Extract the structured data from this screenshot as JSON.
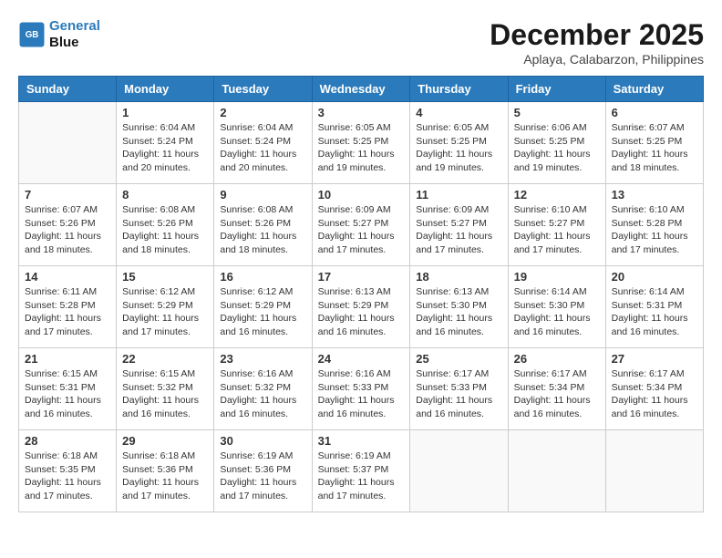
{
  "header": {
    "logo_line1": "General",
    "logo_line2": "Blue",
    "month": "December 2025",
    "location": "Aplaya, Calabarzon, Philippines"
  },
  "weekdays": [
    "Sunday",
    "Monday",
    "Tuesday",
    "Wednesday",
    "Thursday",
    "Friday",
    "Saturday"
  ],
  "weeks": [
    [
      {
        "day": "",
        "info": ""
      },
      {
        "day": "1",
        "info": "Sunrise: 6:04 AM\nSunset: 5:24 PM\nDaylight: 11 hours\nand 20 minutes."
      },
      {
        "day": "2",
        "info": "Sunrise: 6:04 AM\nSunset: 5:24 PM\nDaylight: 11 hours\nand 20 minutes."
      },
      {
        "day": "3",
        "info": "Sunrise: 6:05 AM\nSunset: 5:25 PM\nDaylight: 11 hours\nand 19 minutes."
      },
      {
        "day": "4",
        "info": "Sunrise: 6:05 AM\nSunset: 5:25 PM\nDaylight: 11 hours\nand 19 minutes."
      },
      {
        "day": "5",
        "info": "Sunrise: 6:06 AM\nSunset: 5:25 PM\nDaylight: 11 hours\nand 19 minutes."
      },
      {
        "day": "6",
        "info": "Sunrise: 6:07 AM\nSunset: 5:25 PM\nDaylight: 11 hours\nand 18 minutes."
      }
    ],
    [
      {
        "day": "7",
        "info": "Sunrise: 6:07 AM\nSunset: 5:26 PM\nDaylight: 11 hours\nand 18 minutes."
      },
      {
        "day": "8",
        "info": "Sunrise: 6:08 AM\nSunset: 5:26 PM\nDaylight: 11 hours\nand 18 minutes."
      },
      {
        "day": "9",
        "info": "Sunrise: 6:08 AM\nSunset: 5:26 PM\nDaylight: 11 hours\nand 18 minutes."
      },
      {
        "day": "10",
        "info": "Sunrise: 6:09 AM\nSunset: 5:27 PM\nDaylight: 11 hours\nand 17 minutes."
      },
      {
        "day": "11",
        "info": "Sunrise: 6:09 AM\nSunset: 5:27 PM\nDaylight: 11 hours\nand 17 minutes."
      },
      {
        "day": "12",
        "info": "Sunrise: 6:10 AM\nSunset: 5:27 PM\nDaylight: 11 hours\nand 17 minutes."
      },
      {
        "day": "13",
        "info": "Sunrise: 6:10 AM\nSunset: 5:28 PM\nDaylight: 11 hours\nand 17 minutes."
      }
    ],
    [
      {
        "day": "14",
        "info": "Sunrise: 6:11 AM\nSunset: 5:28 PM\nDaylight: 11 hours\nand 17 minutes."
      },
      {
        "day": "15",
        "info": "Sunrise: 6:12 AM\nSunset: 5:29 PM\nDaylight: 11 hours\nand 17 minutes."
      },
      {
        "day": "16",
        "info": "Sunrise: 6:12 AM\nSunset: 5:29 PM\nDaylight: 11 hours\nand 16 minutes."
      },
      {
        "day": "17",
        "info": "Sunrise: 6:13 AM\nSunset: 5:29 PM\nDaylight: 11 hours\nand 16 minutes."
      },
      {
        "day": "18",
        "info": "Sunrise: 6:13 AM\nSunset: 5:30 PM\nDaylight: 11 hours\nand 16 minutes."
      },
      {
        "day": "19",
        "info": "Sunrise: 6:14 AM\nSunset: 5:30 PM\nDaylight: 11 hours\nand 16 minutes."
      },
      {
        "day": "20",
        "info": "Sunrise: 6:14 AM\nSunset: 5:31 PM\nDaylight: 11 hours\nand 16 minutes."
      }
    ],
    [
      {
        "day": "21",
        "info": "Sunrise: 6:15 AM\nSunset: 5:31 PM\nDaylight: 11 hours\nand 16 minutes."
      },
      {
        "day": "22",
        "info": "Sunrise: 6:15 AM\nSunset: 5:32 PM\nDaylight: 11 hours\nand 16 minutes."
      },
      {
        "day": "23",
        "info": "Sunrise: 6:16 AM\nSunset: 5:32 PM\nDaylight: 11 hours\nand 16 minutes."
      },
      {
        "day": "24",
        "info": "Sunrise: 6:16 AM\nSunset: 5:33 PM\nDaylight: 11 hours\nand 16 minutes."
      },
      {
        "day": "25",
        "info": "Sunrise: 6:17 AM\nSunset: 5:33 PM\nDaylight: 11 hours\nand 16 minutes."
      },
      {
        "day": "26",
        "info": "Sunrise: 6:17 AM\nSunset: 5:34 PM\nDaylight: 11 hours\nand 16 minutes."
      },
      {
        "day": "27",
        "info": "Sunrise: 6:17 AM\nSunset: 5:34 PM\nDaylight: 11 hours\nand 16 minutes."
      }
    ],
    [
      {
        "day": "28",
        "info": "Sunrise: 6:18 AM\nSunset: 5:35 PM\nDaylight: 11 hours\nand 17 minutes."
      },
      {
        "day": "29",
        "info": "Sunrise: 6:18 AM\nSunset: 5:36 PM\nDaylight: 11 hours\nand 17 minutes."
      },
      {
        "day": "30",
        "info": "Sunrise: 6:19 AM\nSunset: 5:36 PM\nDaylight: 11 hours\nand 17 minutes."
      },
      {
        "day": "31",
        "info": "Sunrise: 6:19 AM\nSunset: 5:37 PM\nDaylight: 11 hours\nand 17 minutes."
      },
      {
        "day": "",
        "info": ""
      },
      {
        "day": "",
        "info": ""
      },
      {
        "day": "",
        "info": ""
      }
    ]
  ]
}
